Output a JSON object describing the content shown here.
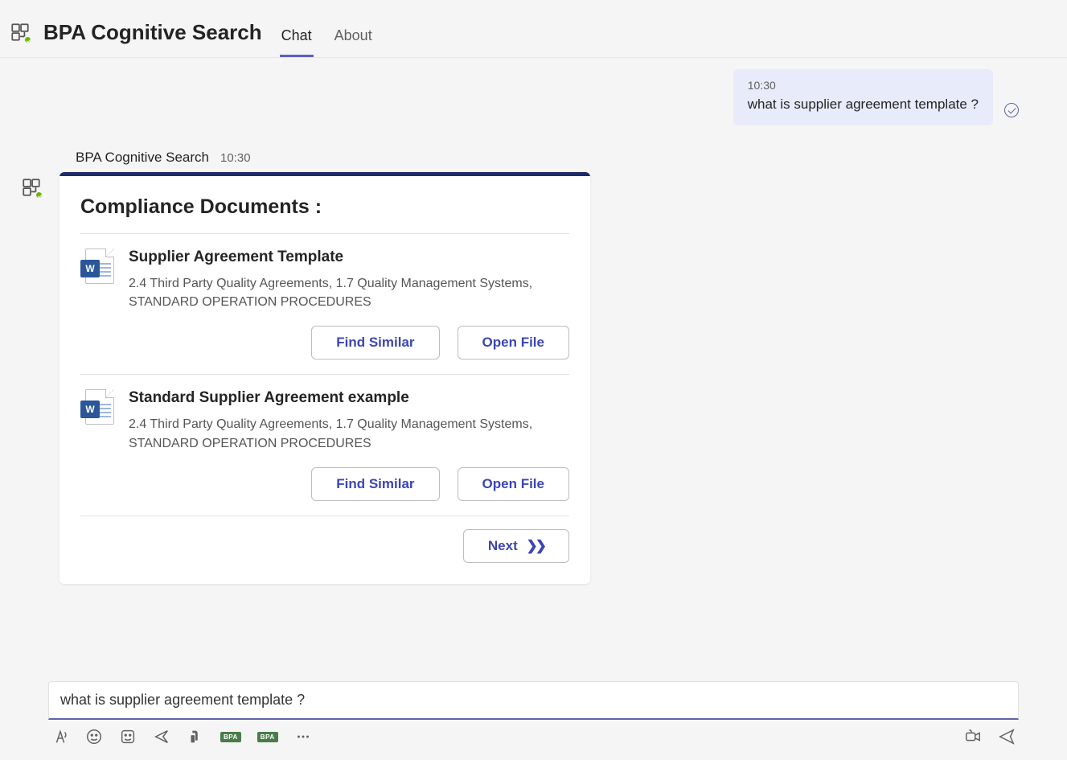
{
  "header": {
    "title": "BPA Cognitive Search",
    "tabs": [
      {
        "label": "Chat",
        "active": true
      },
      {
        "label": "About",
        "active": false
      }
    ]
  },
  "user_message": {
    "time": "10:30",
    "text": "what is supplier agreement template ?"
  },
  "bot_message": {
    "name": "BPA Cognitive Search",
    "time": "10:30",
    "card": {
      "title": "Compliance Documents :",
      "documents": [
        {
          "title": "Supplier Agreement Template",
          "description": "2.4 Third Party Quality Agreements, 1.7 Quality Management Systems, STANDARD OPERATION PROCEDURES",
          "find_similar_label": "Find Similar",
          "open_file_label": "Open File"
        },
        {
          "title": "Standard Supplier Agreement example",
          "description": "2.4 Third Party Quality Agreements, 1.7 Quality Management Systems, STANDARD OPERATION PROCEDURES",
          "find_similar_label": "Find Similar",
          "open_file_label": "Open File"
        }
      ],
      "next_label": "Next"
    }
  },
  "compose": {
    "value": "what is supplier agreement template ?",
    "bpa_tag": "BPA"
  }
}
